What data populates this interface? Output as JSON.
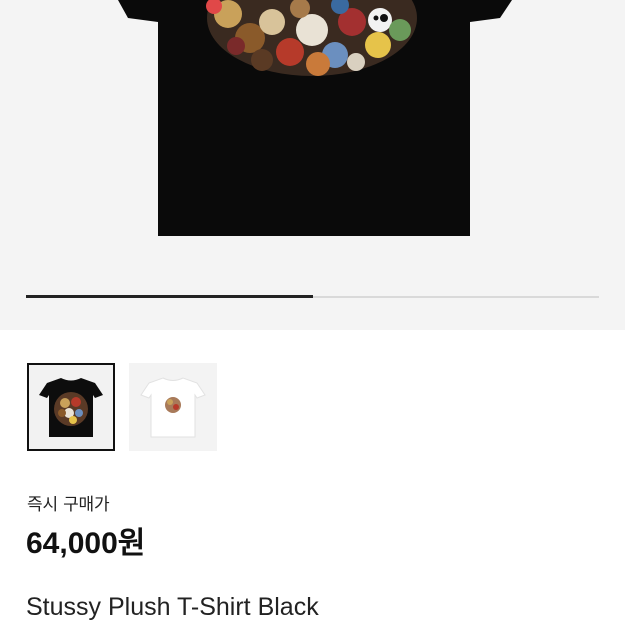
{
  "gallery": {
    "progress_fraction": 0.5,
    "thumbnails": [
      {
        "icon": "black-tshirt-thumbnail",
        "selected": true
      },
      {
        "icon": "white-tshirt-thumbnail",
        "selected": false
      }
    ]
  },
  "pricing": {
    "label": "즉시 구매가",
    "price": "64,000원"
  },
  "product": {
    "name": "Stussy Plush T-Shirt Black"
  },
  "colors": {
    "shirt_black": "#0a0a0a",
    "background": "#f4f4f4",
    "progress_active": "#222222"
  }
}
